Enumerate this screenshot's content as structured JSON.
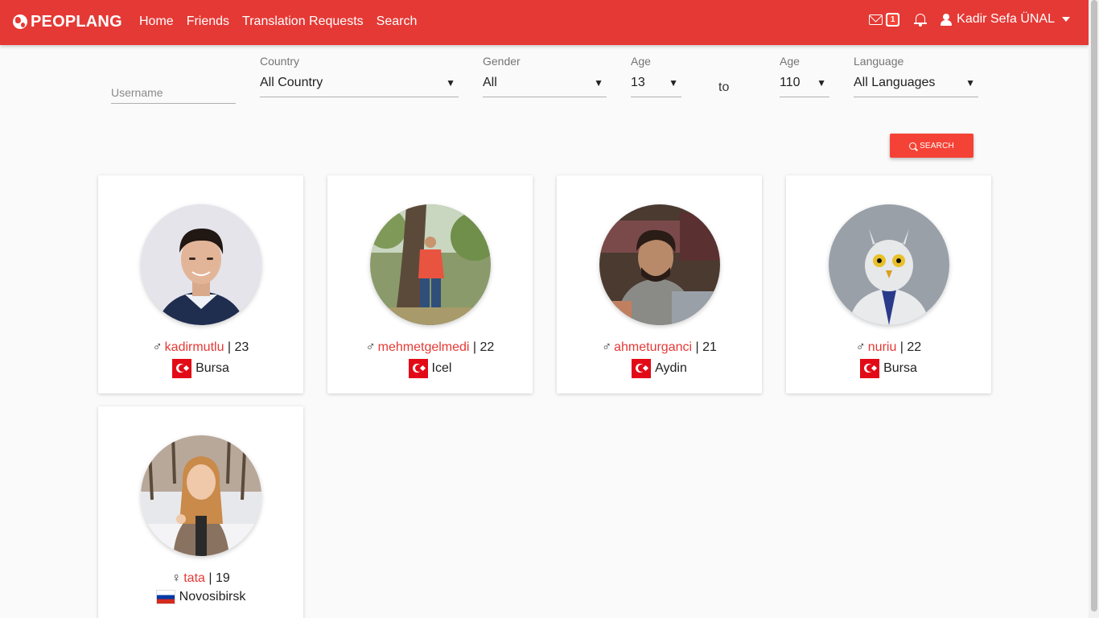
{
  "nav": {
    "brand": "PEOPLANG",
    "links": [
      "Home",
      "Friends",
      "Translation Requests",
      "Search"
    ],
    "message_count": "1",
    "user_name": "Kadir Sefa ÜNAL",
    "accent_color": "#e53935"
  },
  "filters": {
    "username_placeholder": "Username",
    "country": {
      "label": "Country",
      "value": "All Country"
    },
    "gender": {
      "label": "Gender",
      "value": "All"
    },
    "age_from": {
      "label": "Age",
      "value": "13"
    },
    "to_label": "to",
    "age_to": {
      "label": "Age",
      "value": "110"
    },
    "language": {
      "label": "Language",
      "value": "All Languages"
    },
    "search_button": "SEARCH"
  },
  "users": [
    {
      "gender_symbol": "♂",
      "username": "kadirmutlu",
      "age": "23",
      "city": "Bursa",
      "flag": "turkey-flag-icon"
    },
    {
      "gender_symbol": "♂",
      "username": "mehmetgelmedi",
      "age": "22",
      "city": "Icel",
      "flag": "turkey-flag-icon"
    },
    {
      "gender_symbol": "♂",
      "username": "ahmeturganci",
      "age": "21",
      "city": "Aydin",
      "flag": "turkey-flag-icon"
    },
    {
      "gender_symbol": "♂",
      "username": "nuriu",
      "age": "22",
      "city": "Bursa",
      "flag": "turkey-flag-icon"
    },
    {
      "gender_symbol": "♀",
      "username": "tata",
      "age": "19",
      "city": "Novosibirsk",
      "flag": "russia-flag-icon"
    }
  ]
}
